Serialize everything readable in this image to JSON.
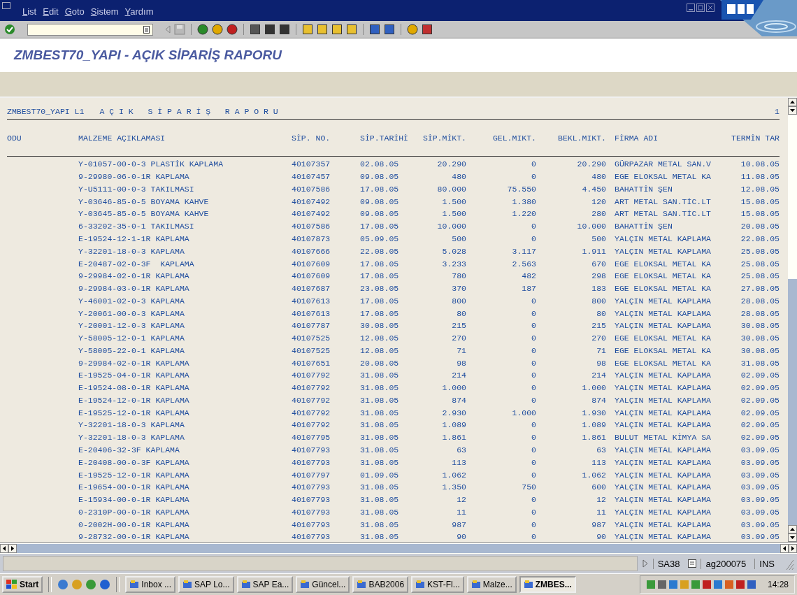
{
  "menu": [
    "List",
    "Edit",
    "Goto",
    "Sistem",
    "Yardım"
  ],
  "title": "ZMBEST70_YAPI - AÇIK SİPARİŞ RAPORU",
  "list_header": {
    "program": "ZMBEST70_YAPI L1",
    "heading": "A Ç I K   S İ P A R İ Ş   R A P O R U",
    "page": "1"
  },
  "columns": [
    "ODU",
    "MALZEME AÇIKLAMASI",
    "SİP. NO.",
    "SİP.TARİHİ",
    "SİP.MİKT.",
    "GEL.MIKT.",
    "BEKL.MIKT.",
    "FİRMA ADI",
    "TERMİN TAR"
  ],
  "rows": [
    [
      "Y-01057-00-0-3 PLASTİK KAPLAMA",
      "40107357",
      "02.08.05",
      "20.290",
      "0",
      "20.290",
      "GÜRPAZAR METAL SAN.V",
      "10.08.05"
    ],
    [
      "9-29980-06-0-1R KAPLAMA",
      "40107457",
      "09.08.05",
      "480",
      "0",
      "480",
      "EGE ELOKSAL METAL KA",
      "11.08.05"
    ],
    [
      "Y-U5111-00-0-3 TAKILMASI",
      "40107586",
      "17.08.05",
      "80.000",
      "75.550",
      "4.450",
      "BAHATTİN ŞEN",
      "12.08.05"
    ],
    [
      "Y-03646-85-0-5 BOYAMA KAHVE",
      "40107492",
      "09.08.05",
      "1.500",
      "1.380",
      "120",
      "ART METAL SAN.TİC.LT",
      "15.08.05"
    ],
    [
      "Y-03645-85-0-5 BOYAMA KAHVE",
      "40107492",
      "09.08.05",
      "1.500",
      "1.220",
      "280",
      "ART METAL SAN.TİC.LT",
      "15.08.05"
    ],
    [
      "6-33202-35-0-1 TAKILMASI",
      "40107586",
      "17.08.05",
      "10.000",
      "0",
      "10.000",
      "BAHATTİN ŞEN",
      "20.08.05"
    ],
    [
      "E-19524-12-1-1R KAPLAMA",
      "40107873",
      "05.09.05",
      "500",
      "0",
      "500",
      "YALÇIN METAL KAPLAMA",
      "22.08.05"
    ],
    [
      "Y-32201-18-0-3 KAPLAMA",
      "40107666",
      "22.08.05",
      "5.028",
      "3.117",
      "1.911",
      "YALÇIN METAL KAPLAMA",
      "25.08.05"
    ],
    [
      "E-20487-02-0-3F  KAPLAMA",
      "40107609",
      "17.08.05",
      "3.233",
      "2.563",
      "670",
      "EGE ELOKSAL METAL KA",
      "25.08.05"
    ],
    [
      "9-29984-02-0-1R KAPLAMA",
      "40107609",
      "17.08.05",
      "780",
      "482",
      "298",
      "EGE ELOKSAL METAL KA",
      "25.08.05"
    ],
    [
      "9-29984-03-0-1R KAPLAMA",
      "40107687",
      "23.08.05",
      "370",
      "187",
      "183",
      "EGE ELOKSAL METAL KA",
      "27.08.05"
    ],
    [
      "Y-46001-02-0-3 KAPLAMA",
      "40107613",
      "17.08.05",
      "800",
      "0",
      "800",
      "YALÇIN METAL KAPLAMA",
      "28.08.05"
    ],
    [
      "Y-20061-00-0-3 KAPLAMA",
      "40107613",
      "17.08.05",
      "80",
      "0",
      "80",
      "YALÇIN METAL KAPLAMA",
      "28.08.05"
    ],
    [
      "Y-20001-12-0-3 KAPLAMA",
      "40107787",
      "30.08.05",
      "215",
      "0",
      "215",
      "YALÇIN METAL KAPLAMA",
      "30.08.05"
    ],
    [
      "Y-58005-12-0-1 KAPLAMA",
      "40107525",
      "12.08.05",
      "270",
      "0",
      "270",
      "EGE ELOKSAL METAL KA",
      "30.08.05"
    ],
    [
      "Y-58005-22-0-1 KAPLAMA",
      "40107525",
      "12.08.05",
      "71",
      "0",
      "71",
      "EGE ELOKSAL METAL KA",
      "30.08.05"
    ],
    [
      "9-29984-02-0-1R KAPLAMA",
      "40107651",
      "20.08.05",
      "98",
      "0",
      "98",
      "EGE ELOKSAL METAL KA",
      "31.08.05"
    ],
    [
      "E-19525-04-0-1R KAPLAMA",
      "40107792",
      "31.08.05",
      "214",
      "0",
      "214",
      "YALÇIN METAL KAPLAMA",
      "02.09.05"
    ],
    [
      "E-19524-08-0-1R KAPLAMA",
      "40107792",
      "31.08.05",
      "1.000",
      "0",
      "1.000",
      "YALÇIN METAL KAPLAMA",
      "02.09.05"
    ],
    [
      "E-19524-12-0-1R KAPLAMA",
      "40107792",
      "31.08.05",
      "874",
      "0",
      "874",
      "YALÇIN METAL KAPLAMA",
      "02.09.05"
    ],
    [
      "E-19525-12-0-1R KAPLAMA",
      "40107792",
      "31.08.05",
      "2.930",
      "1.000",
      "1.930",
      "YALÇIN METAL KAPLAMA",
      "02.09.05"
    ],
    [
      "Y-32201-18-0-3 KAPLAMA",
      "40107792",
      "31.08.05",
      "1.089",
      "0",
      "1.089",
      "YALÇIN METAL KAPLAMA",
      "02.09.05"
    ],
    [
      "Y-32201-18-0-3 KAPLAMA",
      "40107795",
      "31.08.05",
      "1.861",
      "0",
      "1.861",
      "BULUT METAL KİMYA SA",
      "02.09.05"
    ],
    [
      "E-20406-32-3F KAPLAMA",
      "40107793",
      "31.08.05",
      "63",
      "0",
      "63",
      "YALÇIN METAL KAPLAMA",
      "03.09.05"
    ],
    [
      "E-20408-00-0-3F KAPLAMA",
      "40107793",
      "31.08.05",
      "113",
      "0",
      "113",
      "YALÇIN METAL KAPLAMA",
      "03.09.05"
    ],
    [
      "E-19525-12-0-1R KAPLAMA",
      "40107797",
      "01.09.05",
      "1.062",
      "0",
      "1.062",
      "YALÇIN METAL KAPLAMA",
      "03.09.05"
    ],
    [
      "E-19654-00-0-1R KAPLAMA",
      "40107793",
      "31.08.05",
      "1.350",
      "750",
      "600",
      "YALÇIN METAL KAPLAMA",
      "03.09.05"
    ],
    [
      "E-15934-00-0-1R KAPLAMA",
      "40107793",
      "31.08.05",
      "12",
      "0",
      "12",
      "YALÇIN METAL KAPLAMA",
      "03.09.05"
    ],
    [
      "0-2310P-00-0-1R KAPLAMA",
      "40107793",
      "31.08.05",
      "11",
      "0",
      "11",
      "YALÇIN METAL KAPLAMA",
      "03.09.05"
    ],
    [
      "0-2002H-00-0-1R KAPLAMA",
      "40107793",
      "31.08.05",
      "987",
      "0",
      "987",
      "YALÇIN METAL KAPLAMA",
      "03.09.05"
    ],
    [
      "9-28732-00-0-1R KAPLAMA",
      "40107793",
      "31.08.05",
      "90",
      "0",
      "90",
      "YALÇIN METAL KAPLAMA",
      "03.09.05"
    ]
  ],
  "status_bar": {
    "system": "SA38",
    "user": "ag200075",
    "mode": "INS"
  },
  "taskbar": {
    "start": "Start",
    "tasks": [
      {
        "label": "Inbox ...",
        "selected": false
      },
      {
        "label": "SAP Lo...",
        "selected": false
      },
      {
        "label": "SAP Ea...",
        "selected": false
      },
      {
        "label": "Güncel...",
        "selected": false
      },
      {
        "label": "BAB2006",
        "selected": false
      },
      {
        "label": "KST-Fl...",
        "selected": false
      },
      {
        "label": "Malze...",
        "selected": false
      },
      {
        "label": "ZMBES...",
        "selected": true
      }
    ],
    "clock": "14:28"
  }
}
